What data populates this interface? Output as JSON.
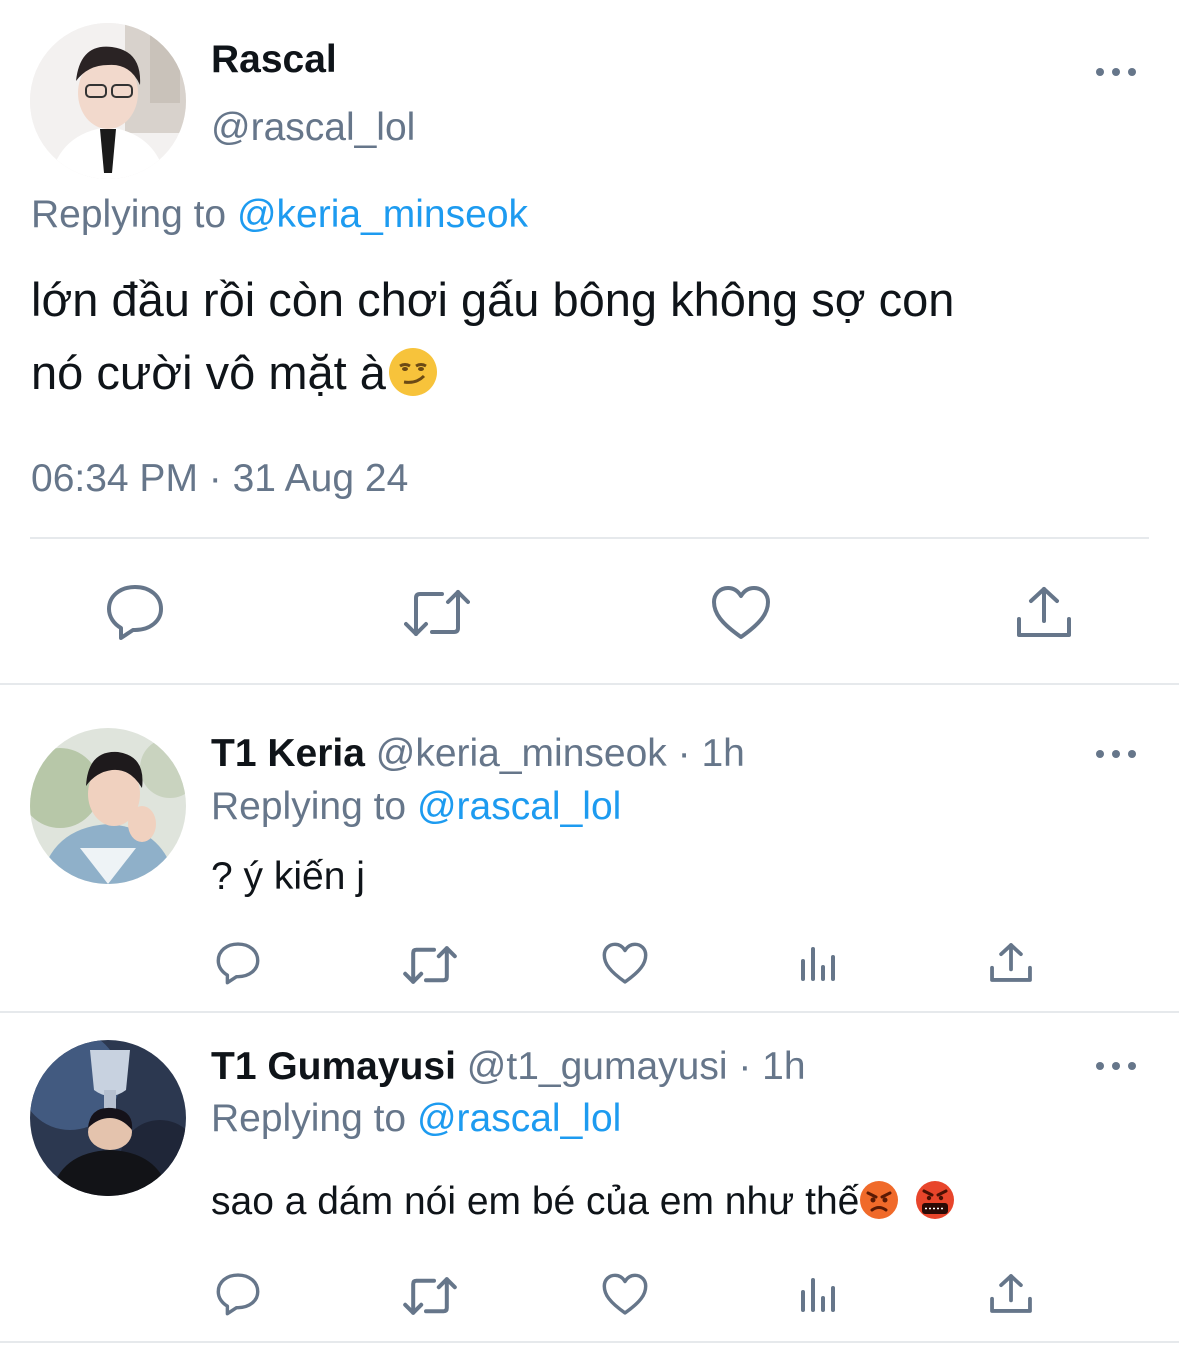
{
  "main_tweet": {
    "display_name": "Rascal",
    "handle": "@rascal_lol",
    "replying_prefix": "Replying to",
    "replying_handle": "@keria_minseok",
    "text_line1": "lớn đầu rồi còn chơi gấu bông không sợ con",
    "text_line2": "nó cười vô mặt à",
    "text_emoji": "smirking-face",
    "timestamp": "06:34 PM · 31 Aug 24",
    "actions": [
      "reply-icon",
      "retweet-icon",
      "like-icon",
      "share-icon"
    ]
  },
  "replies": [
    {
      "display_name": "T1 Keria",
      "handle": "@keria_minseok",
      "time": "· 1h",
      "replying_prefix": "Replying to",
      "replying_handle": "@rascal_lol",
      "text": "? ý kiến j",
      "actions": [
        "reply-icon",
        "retweet-icon",
        "like-icon",
        "analytics-icon",
        "share-icon"
      ]
    },
    {
      "display_name": "T1 Gumayusi",
      "handle": "@t1_gumayusi",
      "time": "· 1h",
      "replying_prefix": "Replying to",
      "replying_handle": "@rascal_lol",
      "text": "sao a dám nói em bé của em như thế",
      "text_emojis": [
        "angry-face",
        "cursing-face"
      ],
      "actions": [
        "reply-icon",
        "retweet-icon",
        "like-icon",
        "analytics-icon",
        "share-icon"
      ]
    }
  ],
  "colors": {
    "link": "#1d9bf0",
    "muted": "#66768a",
    "text": "#0f1419",
    "divider": "#e6e9ec"
  }
}
